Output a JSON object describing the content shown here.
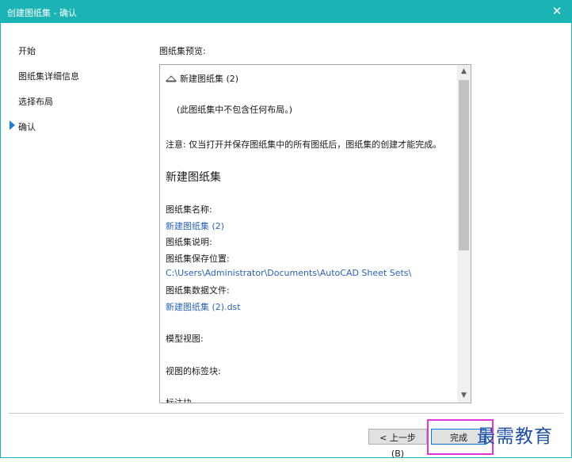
{
  "window": {
    "title": "创建图纸集 - 确认"
  },
  "nav": {
    "items": [
      {
        "label": "开始"
      },
      {
        "label": "图纸集详细信息"
      },
      {
        "label": "选择布局"
      },
      {
        "label": "确认"
      }
    ],
    "active_item": "确认"
  },
  "preview": {
    "label": "图纸集预览:",
    "sheet_set_name_line": "新建图纸集 (2)",
    "no_layouts_note": "(此图纸集中不包含任何布局。)",
    "notice": "注意: 仅当打开并保存图纸集中的所有图纸后，图纸集的创建才能完成。",
    "heading": "新建图纸集",
    "name_label": "图纸集名称:",
    "name_value": "新建图纸集 (2)",
    "description_label": "图纸集说明:",
    "location_label": "图纸集保存位置:",
    "location_value": "C:\\Users\\Administrator\\Documents\\AutoCAD Sheet Sets\\",
    "data_file_label": "图纸集数据文件:",
    "data_file_value": "新建图纸集 (2).dst",
    "model_view_label": "模型视图:",
    "view_label_block_label": "视图的标签块:",
    "partial_line": "标注块"
  },
  "buttons": {
    "back": "< 上一步(B)",
    "finish": "完成"
  },
  "watermark": {
    "text": "最需教育"
  },
  "colors": {
    "titlebar": "#1cb3b5",
    "link": "#2b62b8",
    "nav_arrow": "#1e7fd0",
    "focus_highlight": "#e535d4"
  }
}
